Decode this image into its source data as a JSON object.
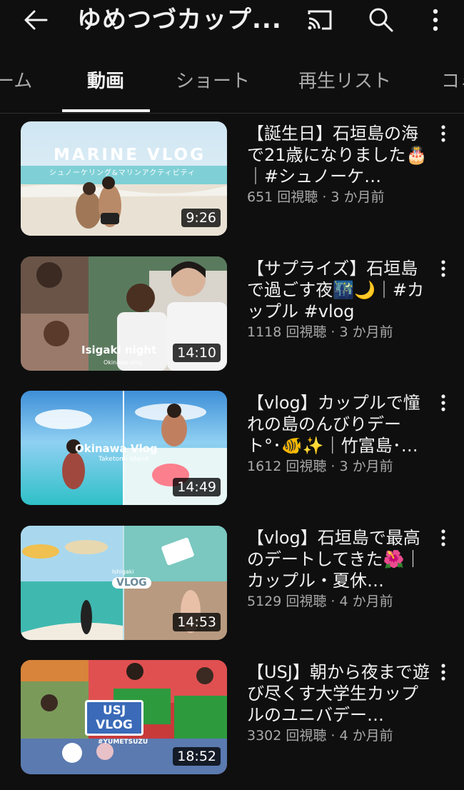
{
  "header": {
    "title": "ゆめつづカップ...",
    "back_icon": "arrow-left-icon",
    "cast_icon": "cast-icon",
    "search_icon": "search-icon",
    "more_icon": "more-vert-icon"
  },
  "tabs": [
    {
      "label": "ーム"
    },
    {
      "label": "動画"
    },
    {
      "label": "ショート"
    },
    {
      "label": "再生リスト"
    },
    {
      "label": "コミ"
    }
  ],
  "active_tab": "動画",
  "videos": [
    {
      "title": "【誕生日】石垣島の海で21歳になりました🎂｜#シュノーケ…",
      "views": "651 回視聴 · 3 か月前",
      "duration": "9:26",
      "thumb_text": "MARINE VLOG",
      "thumb_subtext": "シュノーケリング&マリンアクティビティ"
    },
    {
      "title": "【サプライズ】石垣島で過ごす夜🌃🌙｜#カップル #vlog",
      "views": "1118 回視聴 · 3 か月前",
      "duration": "14:10",
      "thumb_text": "Isigaki night",
      "thumb_subtext": "Okinawa vlog"
    },
    {
      "title": "【vlog】カップルで憧れの島のんびりデート°･🐠✨｜竹富島･…",
      "views": "1612 回視聴 · 3 か月前",
      "duration": "14:49",
      "thumb_text": "Okinawa Vlog",
      "thumb_subtext": "Taketomi island"
    },
    {
      "title": "【vlog】石垣島で最高のデートしてきた🌺｜カップル・夏休…",
      "views": "5129 回視聴 · 4 か月前",
      "duration": "14:53",
      "thumb_text": "VLOG",
      "thumb_subtext": "Ishigaki"
    },
    {
      "title": "【USJ】朝から夜まで遊び尽くす大学生カップルのユニバデー…",
      "views": "3302 回視聴 · 4 か月前",
      "duration": "18:52",
      "thumb_text": "USJ VLOG",
      "thumb_subtext": "#YUMETSUZU"
    }
  ],
  "colors": {
    "background": "#0f0f0f",
    "text_primary": "#f1f1f1",
    "text_secondary": "#aaaaaa"
  }
}
